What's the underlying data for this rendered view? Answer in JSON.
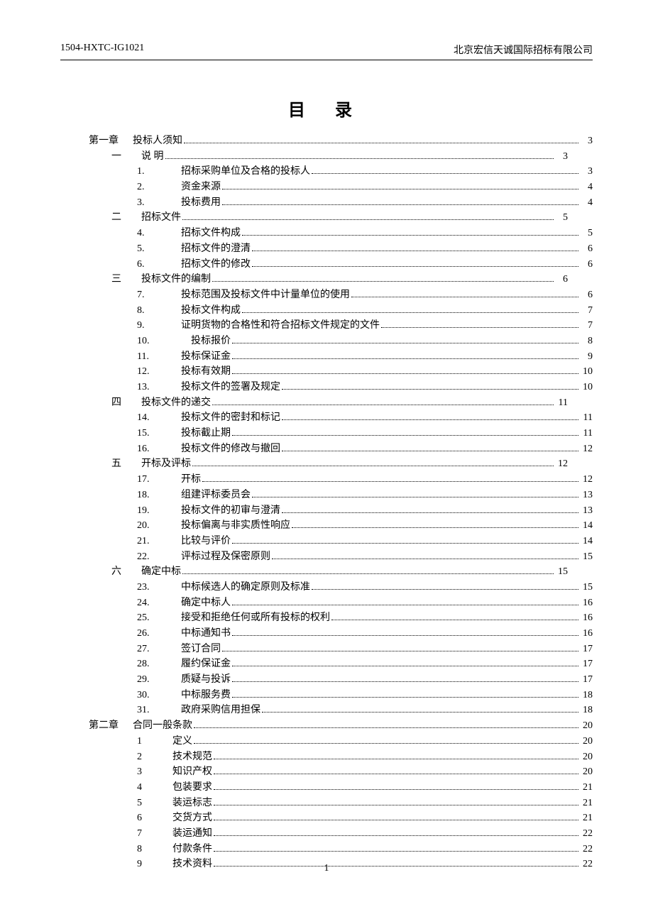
{
  "header": {
    "left": "1504-HXTC-IG1021",
    "right": "北京宏信天诚国际招标有限公司"
  },
  "title": "目 录",
  "page_number": "1",
  "toc": [
    {
      "lvl": "chapter",
      "num": "第一章",
      "label": "投标人须知",
      "page": "3",
      "short": false
    },
    {
      "lvl": "section",
      "num": "一",
      "label": "说    明",
      "page": "3",
      "short": true
    },
    {
      "lvl": "item",
      "num": "1.",
      "label": "招标采购单位及合格的投标人",
      "page": "3",
      "short": false
    },
    {
      "lvl": "item",
      "num": "2.",
      "label": "资金来源",
      "page": "4",
      "short": false
    },
    {
      "lvl": "item",
      "num": "3.",
      "label": "投标费用",
      "page": "4",
      "short": false
    },
    {
      "lvl": "section",
      "num": "二",
      "label": "招标文件",
      "page": "5",
      "short": true
    },
    {
      "lvl": "item",
      "num": "4.",
      "label": "招标文件构成",
      "page": "5",
      "short": false
    },
    {
      "lvl": "item",
      "num": "5.",
      "label": "招标文件的澄清",
      "page": "6",
      "short": false
    },
    {
      "lvl": "item",
      "num": "6.",
      "label": "招标文件的修改",
      "page": "6",
      "short": false
    },
    {
      "lvl": "section",
      "num": "三",
      "label": "投标文件的编制",
      "page": "6",
      "short": true
    },
    {
      "lvl": "item",
      "num": "7.",
      "label": "投标范围及投标文件中计量单位的使用",
      "page": "6",
      "short": false
    },
    {
      "lvl": "item",
      "num": "8.",
      "label": "投标文件构成",
      "page": "7",
      "short": false
    },
    {
      "lvl": "item",
      "num": "9.",
      "label": "证明货物的合格性和符合招标文件规定的文件",
      "page": "7",
      "short": false
    },
    {
      "lvl": "item",
      "num": "10.",
      "label": "投标报价",
      "page": "8",
      "short": false,
      "wider": true
    },
    {
      "lvl": "item",
      "num": "11.",
      "label": "投标保证金",
      "page": "9",
      "short": false
    },
    {
      "lvl": "item",
      "num": "12.",
      "label": "投标有效期",
      "page": "10",
      "short": false
    },
    {
      "lvl": "item",
      "num": "13.",
      "label": "投标文件的签署及规定",
      "page": "10",
      "short": false
    },
    {
      "lvl": "section",
      "num": "四",
      "label": "投标文件的递交",
      "page": "11",
      "short": true
    },
    {
      "lvl": "item",
      "num": "14.",
      "label": "投标文件的密封和标记",
      "page": "11",
      "short": false
    },
    {
      "lvl": "item",
      "num": "15.",
      "label": "投标截止期",
      "page": "11",
      "short": false
    },
    {
      "lvl": "item",
      "num": "16.",
      "label": "投标文件的修改与撤回",
      "page": "12",
      "short": false
    },
    {
      "lvl": "section",
      "num": "五",
      "label": "开标及评标",
      "page": "12",
      "short": true
    },
    {
      "lvl": "item",
      "num": "17.",
      "label": "开标",
      "page": "12",
      "short": false
    },
    {
      "lvl": "item",
      "num": "18.",
      "label": "组建评标委员会",
      "page": "13",
      "short": false
    },
    {
      "lvl": "item",
      "num": "19.",
      "label": "投标文件的初审与澄清",
      "page": "13",
      "short": false
    },
    {
      "lvl": "item",
      "num": "20.",
      "label": "投标偏离与非实质性响应",
      "page": "14",
      "short": false
    },
    {
      "lvl": "item",
      "num": "21.",
      "label": "比较与评价",
      "page": "14",
      "short": false
    },
    {
      "lvl": "item",
      "num": "22.",
      "label": "评标过程及保密原则",
      "page": "15",
      "short": false
    },
    {
      "lvl": "section",
      "num": "六",
      "label": "确定中标",
      "page": "15",
      "short": true
    },
    {
      "lvl": "item",
      "num": "23.",
      "label": "中标候选人的确定原则及标准",
      "page": "15",
      "short": false
    },
    {
      "lvl": "item",
      "num": "24.",
      "label": "确定中标人",
      "page": "16",
      "short": false
    },
    {
      "lvl": "item",
      "num": "25.",
      "label": "接受和拒绝任何或所有投标的权利",
      "page": "16",
      "short": false
    },
    {
      "lvl": "item",
      "num": "26.",
      "label": "中标通知书",
      "page": "16",
      "short": false
    },
    {
      "lvl": "item",
      "num": "27.",
      "label": "签订合同",
      "page": "17",
      "short": false
    },
    {
      "lvl": "item",
      "num": "28.",
      "label": "履约保证金",
      "page": "17",
      "short": false
    },
    {
      "lvl": "item",
      "num": "29.",
      "label": "质疑与投诉",
      "page": "17",
      "short": false
    },
    {
      "lvl": "item",
      "num": "30.",
      "label": "中标服务费",
      "page": "18",
      "short": false
    },
    {
      "lvl": "item",
      "num": "31.",
      "label": "政府采购信用担保",
      "page": "18",
      "short": false
    },
    {
      "lvl": "chapter",
      "num": "第二章",
      "label": "合同一般条款",
      "page": "20",
      "short": false
    },
    {
      "lvl": "item",
      "num": "1",
      "label": "定义",
      "page": "20",
      "short": false,
      "nonum_dot": true
    },
    {
      "lvl": "item",
      "num": "2",
      "label": "技术规范",
      "page": "20",
      "short": false,
      "nonum_dot": true
    },
    {
      "lvl": "item",
      "num": "3",
      "label": "知识产权",
      "page": "20",
      "short": false,
      "nonum_dot": true
    },
    {
      "lvl": "item",
      "num": "4",
      "label": "包装要求",
      "page": "21",
      "short": false,
      "nonum_dot": true
    },
    {
      "lvl": "item",
      "num": "5",
      "label": "装运标志",
      "page": "21",
      "short": false,
      "nonum_dot": true
    },
    {
      "lvl": "item",
      "num": "6",
      "label": "交货方式",
      "page": "21",
      "short": false,
      "nonum_dot": true
    },
    {
      "lvl": "item",
      "num": "7",
      "label": "装运通知",
      "page": "22",
      "short": false,
      "nonum_dot": true
    },
    {
      "lvl": "item",
      "num": "8",
      "label": "付款条件",
      "page": "22",
      "short": false,
      "nonum_dot": true
    },
    {
      "lvl": "item",
      "num": "9",
      "label": "技术资料",
      "page": "22",
      "short": false,
      "nonum_dot": true
    }
  ]
}
